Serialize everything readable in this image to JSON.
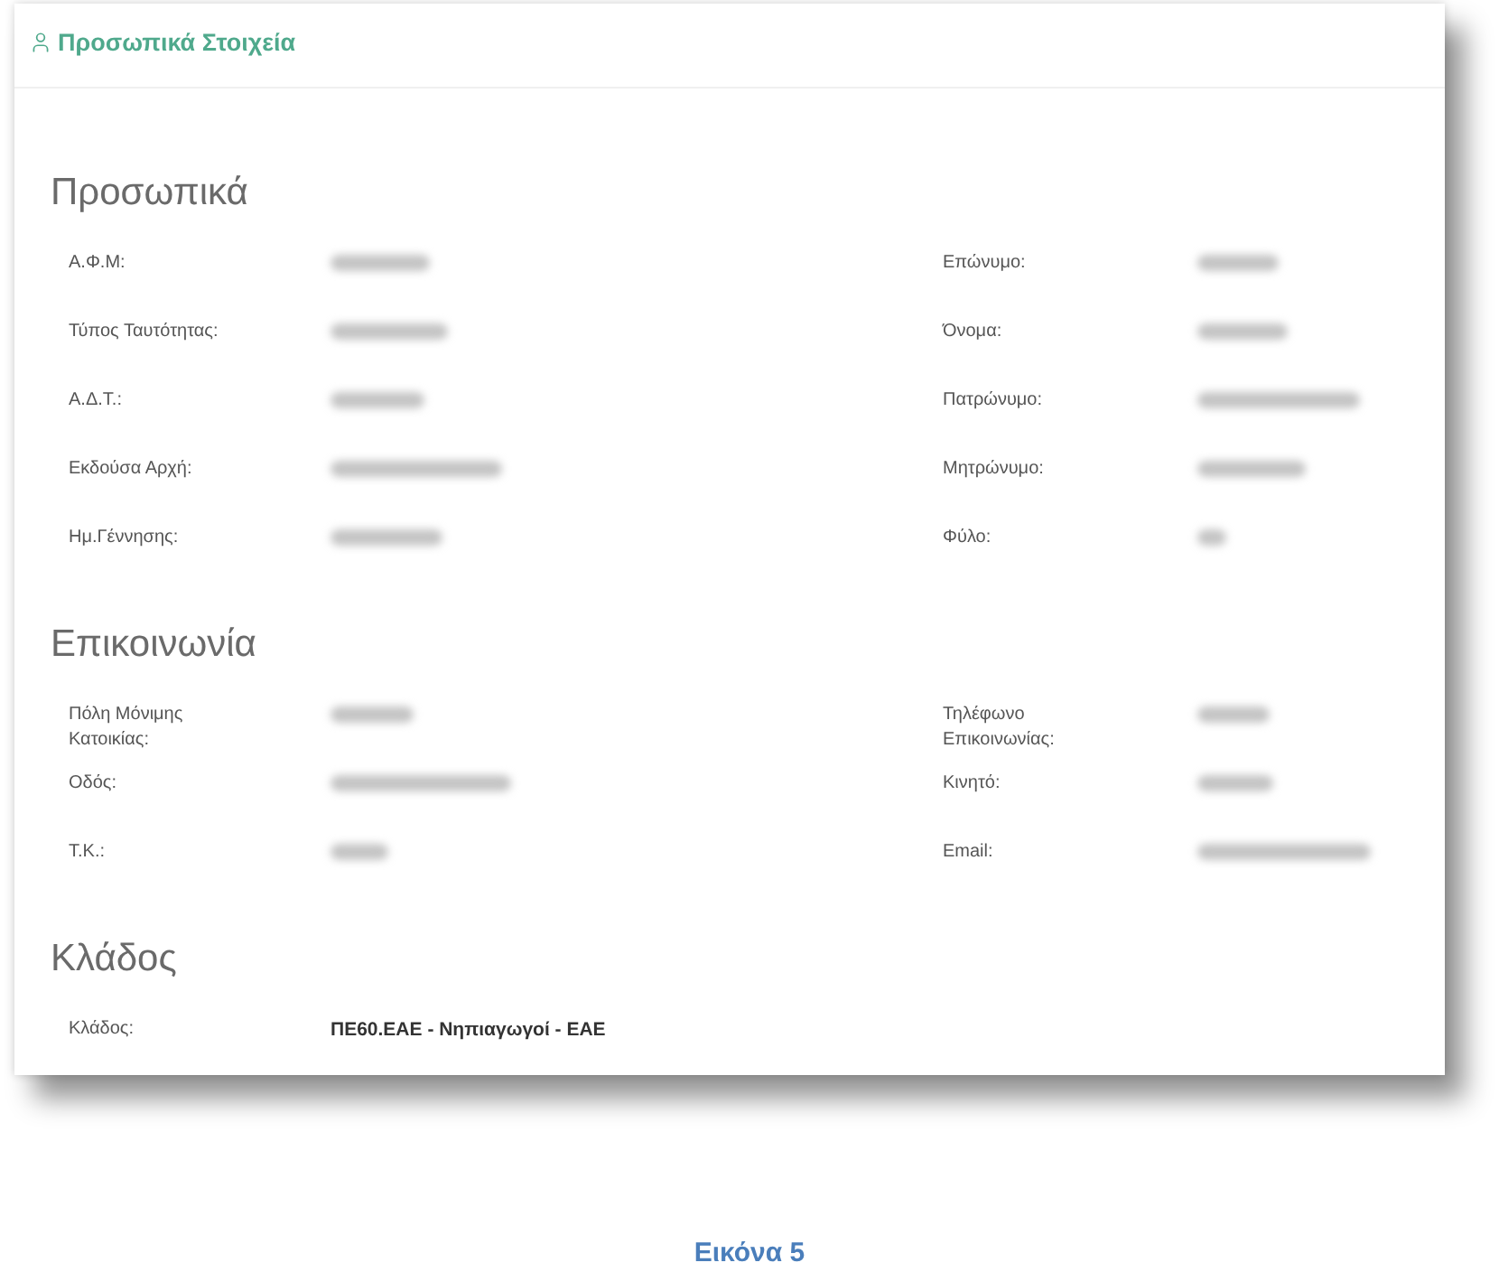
{
  "panel": {
    "title": "Προσωπικά Στοιχεία"
  },
  "sections": [
    {
      "heading": "Προσωπικά",
      "fields": [
        {
          "kind": "blurred",
          "label": "Α.Φ.Μ:"
        },
        {
          "kind": "blurred",
          "label": "Επώνυμο:"
        },
        {
          "kind": "blurred",
          "label": "Τύπος Ταυτότητας:"
        },
        {
          "kind": "blurred",
          "label": "Όνομα:"
        },
        {
          "kind": "blurred",
          "label": "Α.Δ.Τ.:"
        },
        {
          "kind": "blurred",
          "label": "Πατρώνυμο:"
        },
        {
          "kind": "blurred",
          "label": "Εκδούσα Αρχή:"
        },
        {
          "kind": "blurred",
          "label": "Μητρώνυμο:"
        },
        {
          "kind": "blurred",
          "label": "Ημ.Γέννησης:"
        },
        {
          "kind": "blurred",
          "label": "Φύλο:"
        }
      ]
    },
    {
      "heading": "Επικοινωνία",
      "fields": [
        {
          "kind": "blurred",
          "label": "Πόλη Μόνιμης Κατοικίας:"
        },
        {
          "kind": "blurred",
          "label": "Τηλέφωνο Επικοινωνίας:"
        },
        {
          "kind": "blurred",
          "label": "Οδός:"
        },
        {
          "kind": "blurred",
          "label": "Κινητό:"
        },
        {
          "kind": "blurred",
          "label": "Τ.Κ.:"
        },
        {
          "kind": "blurred",
          "label": "Email:"
        }
      ]
    },
    {
      "heading": "Κλάδος",
      "fields": [
        {
          "kind": "text",
          "label": "Κλάδος:",
          "value": "ΠΕ60.ΕΑΕ - Νηπιαγωγοί - ΕΑΕ"
        }
      ]
    }
  ],
  "caption": "Εικόνα 5"
}
